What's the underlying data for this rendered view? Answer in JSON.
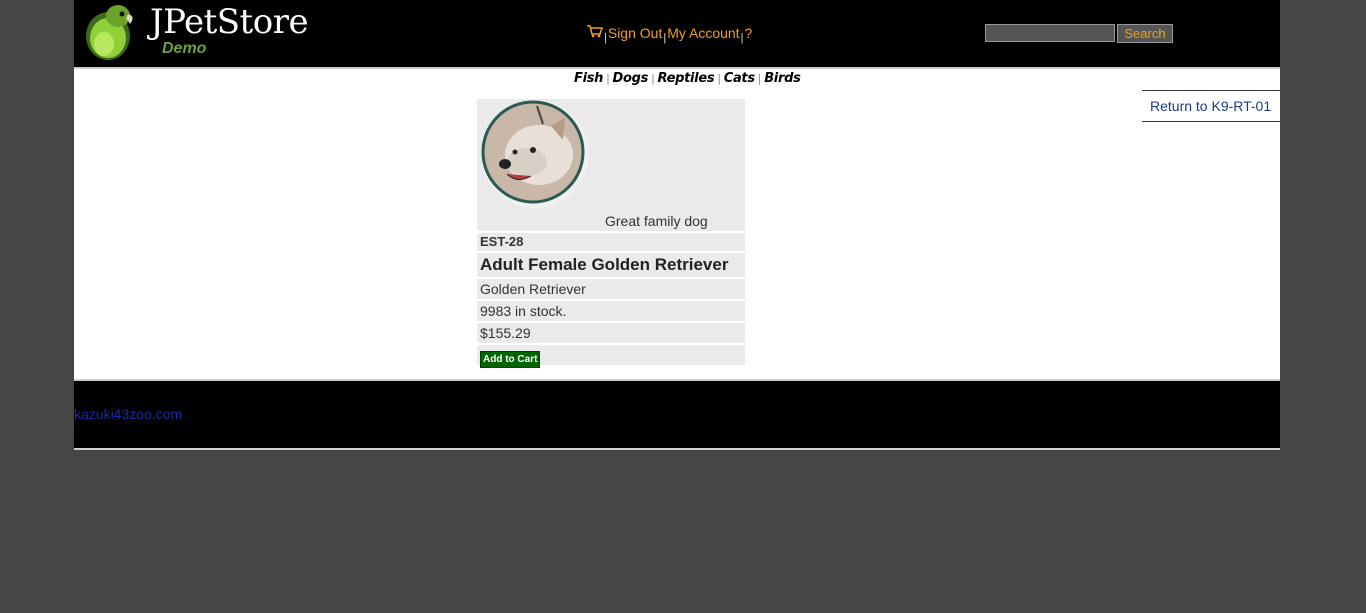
{
  "header": {
    "logo_title": "JPetStore",
    "logo_subtitle": "Demo",
    "menu": {
      "sign_out": "Sign Out",
      "my_account": "My Account",
      "help": "?",
      "separator": "|"
    },
    "search": {
      "value": "",
      "button_label": "Search"
    }
  },
  "quicklinks": [
    "Fish",
    "Dogs",
    "Reptiles",
    "Cats",
    "Birds"
  ],
  "back_link": "Return to K9-RT-01",
  "item": {
    "image_description": "Great family dog",
    "id": "EST-28",
    "name": "Adult Female Golden Retriever",
    "product": "Golden Retriever",
    "stock": "9983 in stock.",
    "price": "$155.29",
    "add_to_cart": "Add to Cart"
  },
  "footer": {
    "text": "kazuki43zoo.com"
  },
  "colors": {
    "background": "#454545",
    "header": "#000000",
    "menu_link": "#f0a020",
    "add_to_cart": "#006400",
    "back_link": "#1a3a8a"
  }
}
